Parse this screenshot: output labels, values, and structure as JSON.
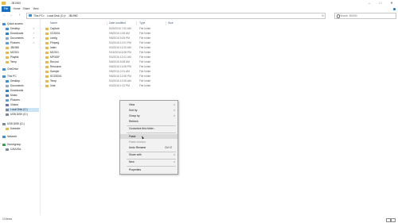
{
  "window": {
    "title": "JB1960",
    "minimize": "–",
    "maximize": "□",
    "close": "✕"
  },
  "ribbon": {
    "tabs": [
      "File",
      "Home",
      "Share",
      "View"
    ]
  },
  "address": {
    "crumbs": [
      "This PC",
      ">",
      "Local Disk (C:)",
      ">",
      "JB1960"
    ],
    "refresh": "↻"
  },
  "search": {
    "placeholder": "Search JB1960"
  },
  "nav": {
    "back": "←",
    "forward": "→",
    "up": "↑",
    "items": [
      {
        "label": "Quick access",
        "pinned": false
      },
      {
        "label": "Desktop",
        "pinned": true
      },
      {
        "label": "Downloads",
        "pinned": true
      },
      {
        "label": "Documents",
        "pinned": true
      },
      {
        "label": "Pictures",
        "pinned": true
      },
      {
        "label": "JB1960",
        "pinned": false
      },
      {
        "label": "MCS01",
        "pinned": false
      },
      {
        "label": "Playlist",
        "pinned": false
      },
      {
        "label": "Temp",
        "pinned": false
      },
      {
        "label": "OneDrive",
        "pinned": false
      },
      {
        "label": "This PC",
        "pinned": false
      },
      {
        "label": "Desktop",
        "pinned": false
      },
      {
        "label": "Documents",
        "pinned": false
      },
      {
        "label": "Downloads",
        "pinned": false
      },
      {
        "label": "Music",
        "pinned": false
      },
      {
        "label": "Pictures",
        "pinned": false
      },
      {
        "label": "Videos",
        "pinned": false
      },
      {
        "label": "Local Disk (C:)",
        "pinned": false
      },
      {
        "label": "USB DISK (D:)",
        "pinned": false
      },
      {
        "label": "USB DISK (D:)",
        "pinned": false
      },
      {
        "label": "Karaoke",
        "pinned": false
      },
      {
        "label": "Network",
        "pinned": false
      },
      {
        "label": "Homegroup",
        "pinned": false
      },
      {
        "label": "CAVUSA",
        "pinned": false
      }
    ],
    "pin_glyph": "↗"
  },
  "columns": [
    "Name",
    "Date modified",
    "Type",
    "Size"
  ],
  "files": [
    {
      "name": "Capture",
      "date": "9/25/2016 7:00 AM",
      "type": "File folder"
    },
    {
      "name": "CDS001",
      "date": "9/8/2016 4:26 AM",
      "type": "File folder"
    },
    {
      "name": "config",
      "date": "9/8/2016 5:05 PM",
      "type": "File folder"
    },
    {
      "name": "Ffmpeg",
      "date": "9/3/2016 12:01 PM",
      "type": "File folder"
    },
    {
      "name": "index",
      "date": "9/3/2016 12:20 AM",
      "type": "File folder"
    },
    {
      "name": "MCS01",
      "date": "9/16/2016 6:08 PM",
      "type": "File folder"
    },
    {
      "name": "MP3GIF",
      "date": "9/3/2016 12:01 AM",
      "type": "File folder"
    },
    {
      "name": "Record",
      "date": "9/8/2016 5:08 AM",
      "type": "File folder"
    },
    {
      "name": "Resource",
      "date": "9/8/2016 12:08 PM",
      "type": "File folder"
    },
    {
      "name": "Sample",
      "date": "9/8/2016 2:01 AM",
      "type": "File folder"
    },
    {
      "name": "SCDS001",
      "date": "9/8/2016 12:08 PM",
      "type": "File folder"
    },
    {
      "name": "Temp",
      "date": "9/3/2016 12:05 AM",
      "type": "File folder"
    },
    {
      "name": "Vote",
      "date": "9/3/2016 1:02 PM",
      "type": "File folder"
    }
  ],
  "context_menu": {
    "view": "View",
    "sort_by": "Sort by",
    "group_by": "Group by",
    "refresh": "Refresh",
    "customize": "Customize this folder...",
    "paste": "Paste",
    "paste_shortcut": "Paste shortcut",
    "undo_rename": "Undo Rename",
    "undo_shortcut": "Ctrl+Z",
    "share_with": "Share with",
    "new": "New",
    "properties": "Properties",
    "arrow": ">"
  },
  "status": {
    "count": "13 items"
  },
  "colors": {
    "accent": "#1a6fc0",
    "folder": "#e8b84a",
    "selected": "#cce4f7"
  }
}
